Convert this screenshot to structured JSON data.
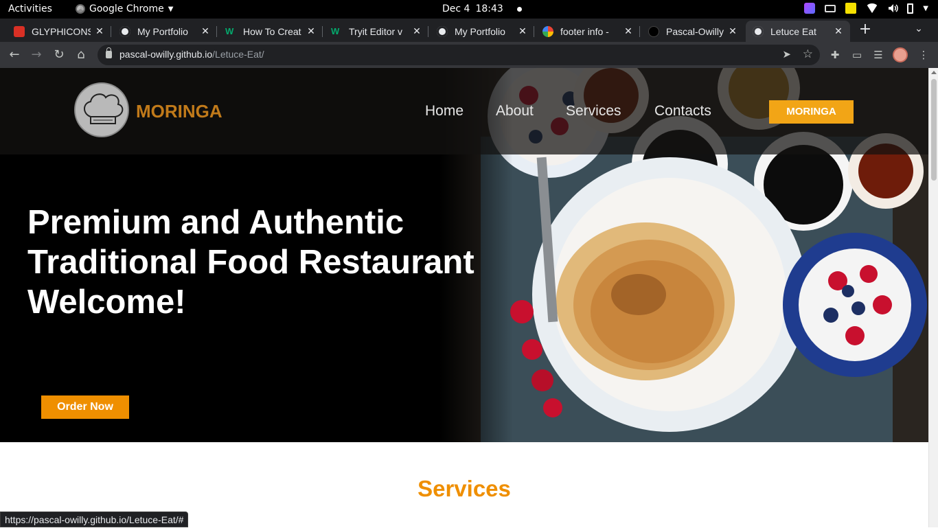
{
  "os_bar": {
    "activities": "Activities",
    "app_name": "Google Chrome",
    "date": "Dec 4",
    "time": "18:43"
  },
  "tabs": [
    {
      "title": "GLYPHICONS",
      "favicon": "red-square-icon"
    },
    {
      "title": "My Portfolio",
      "favicon": "globe-icon"
    },
    {
      "title": "How To Creat",
      "favicon": "w3schools-icon"
    },
    {
      "title": "Tryit Editor v",
      "favicon": "w3schools-icon"
    },
    {
      "title": "My Portfolio",
      "favicon": "globe-icon"
    },
    {
      "title": "footer info -",
      "favicon": "google-icon"
    },
    {
      "title": "Pascal-Owilly",
      "favicon": "github-icon"
    },
    {
      "title": "Letuce Eat",
      "favicon": "globe-icon"
    }
  ],
  "active_tab": 7,
  "address_bar": {
    "host": "pascal-owilly.github.io",
    "path": "/Letuce-Eat/"
  },
  "site": {
    "brand": "MORINGA",
    "nav": [
      "Home",
      "About",
      "Services",
      "Contacts"
    ],
    "nav_button": "MORINGA",
    "headline_lines": [
      "Premium and Authentic",
      "Traditional Food Restaurant",
      "Welcome!"
    ],
    "cta": "Order Now",
    "section_title": "Services",
    "accent_color": "#ef8f00",
    "brand_color": "#c17a1a"
  },
  "status_bar": "https://pascal-owilly.github.io/Letuce-Eat/#"
}
